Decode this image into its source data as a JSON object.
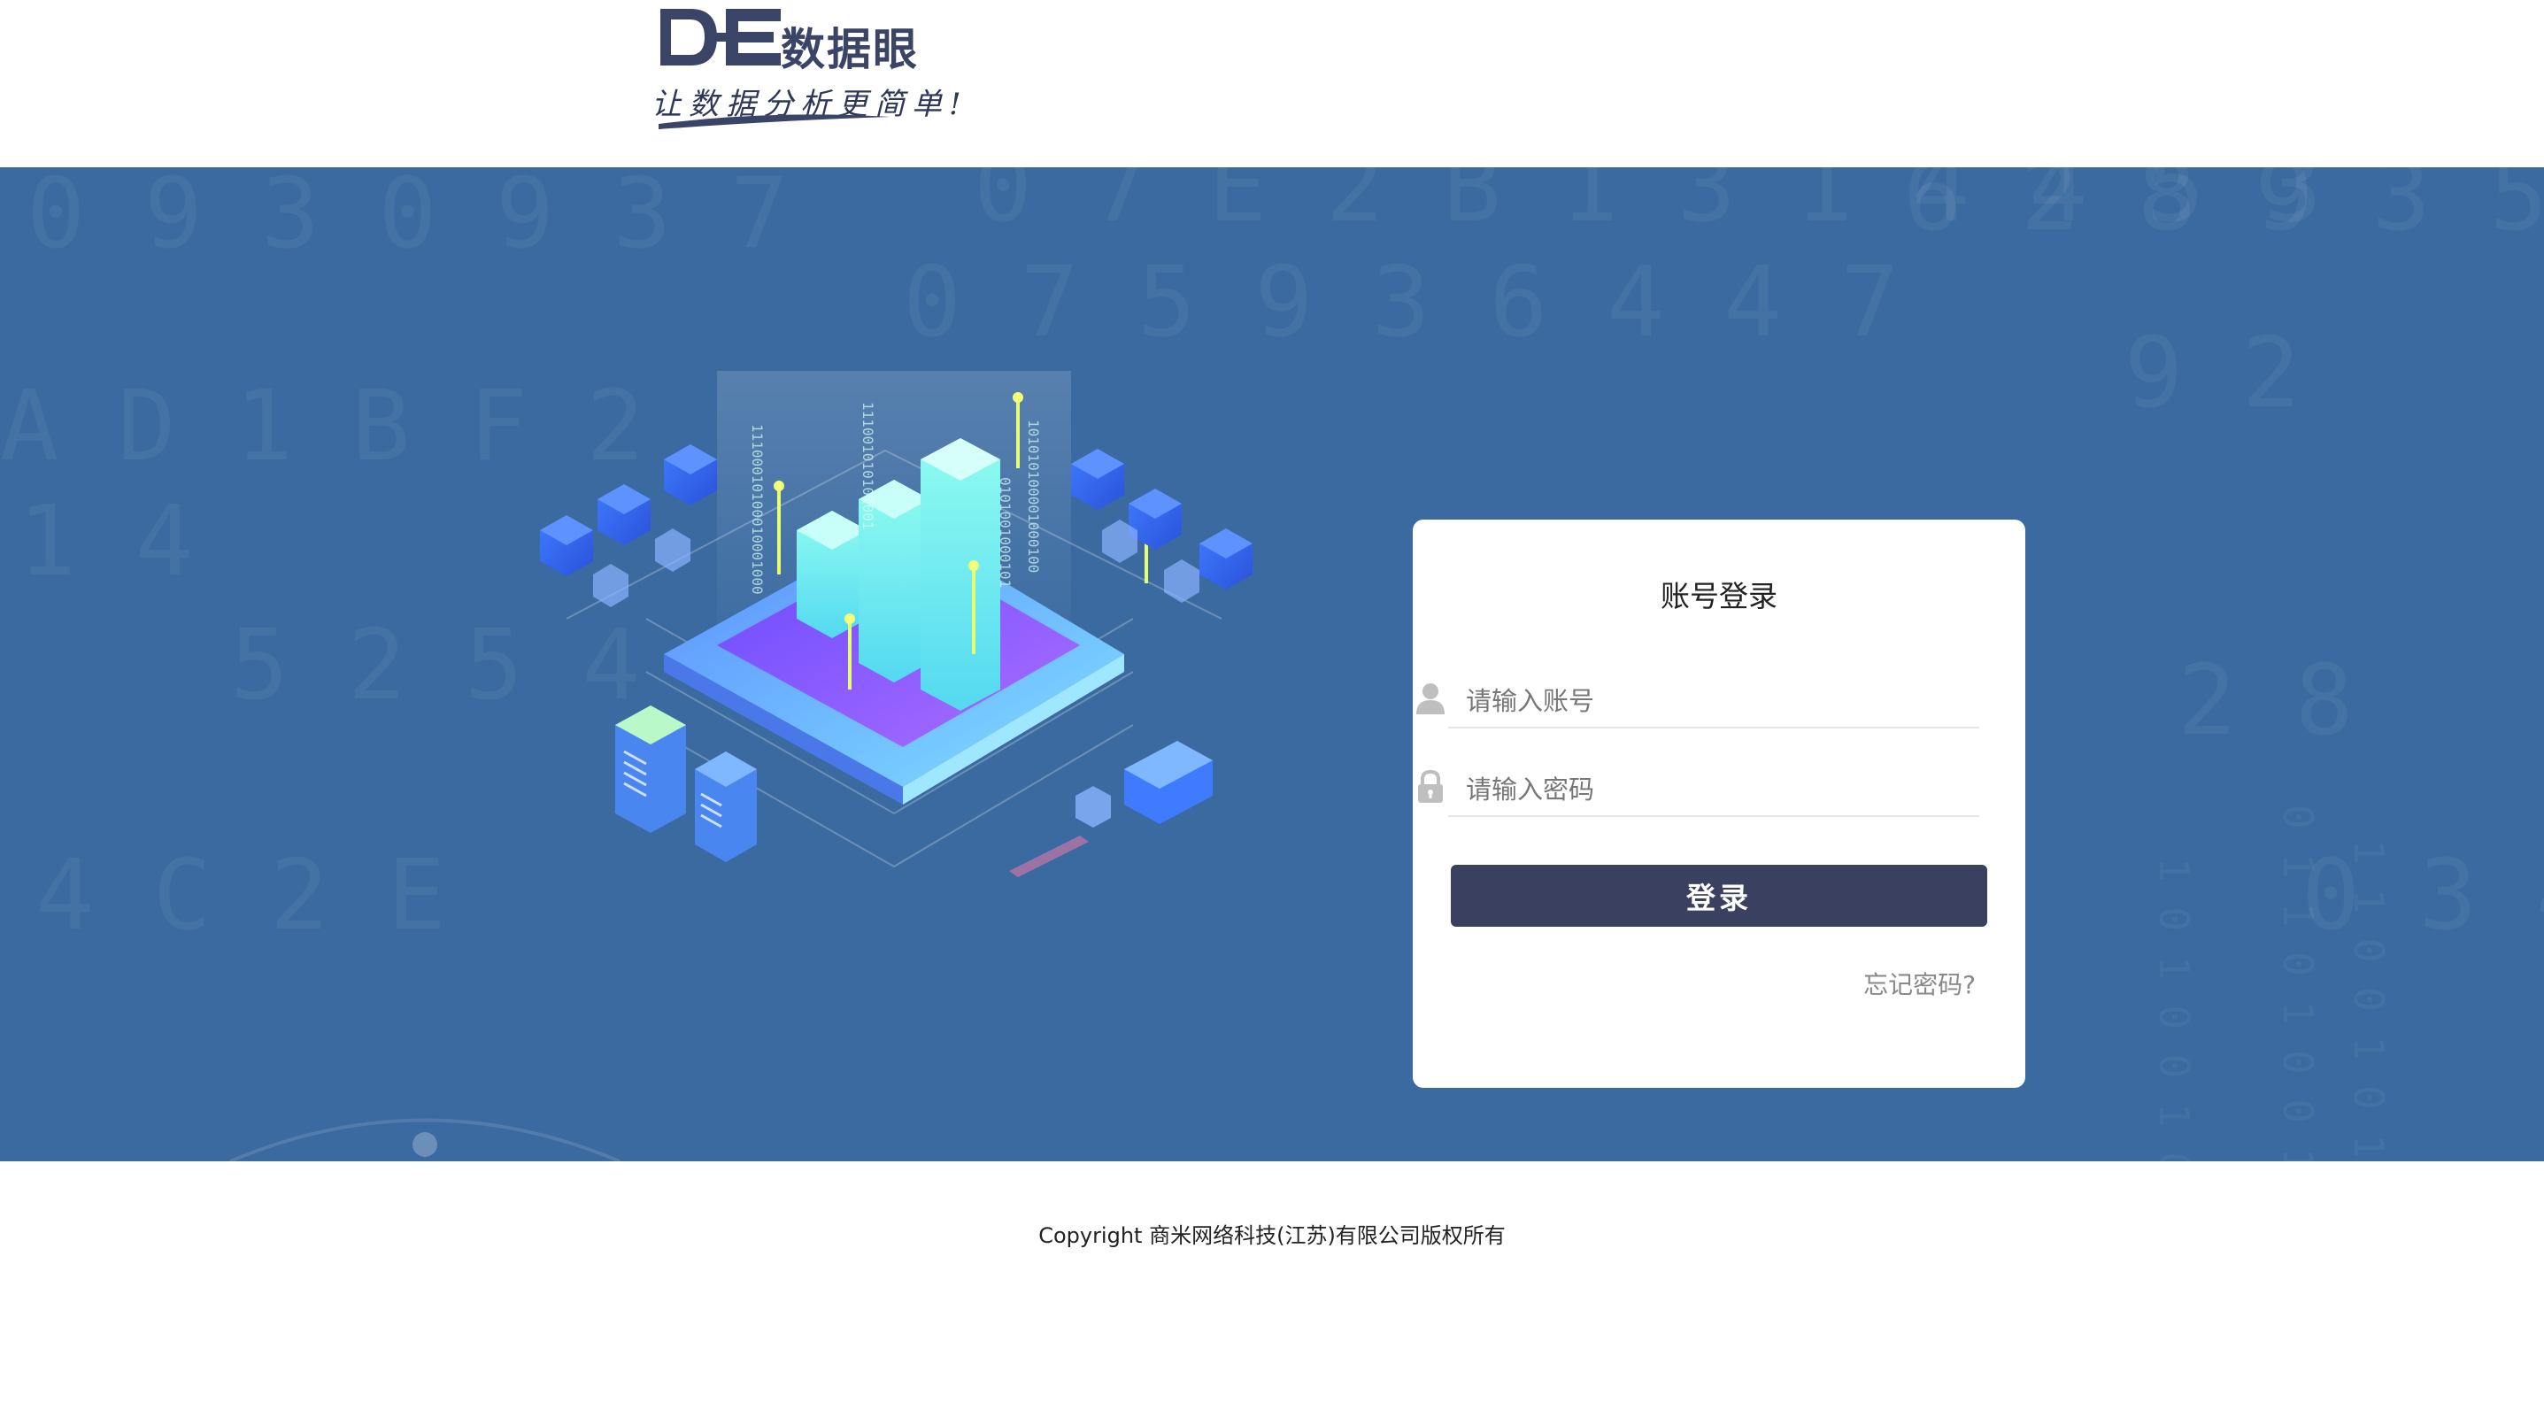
{
  "header": {
    "logo": {
      "brand": "数据眼",
      "slogan": "让数据分析更简单!",
      "mark_letters": "DE"
    }
  },
  "banner": {
    "background_color": "#3a6aa0",
    "illustration": "isometric-data-center"
  },
  "login": {
    "title": "账号登录",
    "username": {
      "placeholder": "请输入账号",
      "value": "",
      "icon": "user-icon"
    },
    "password": {
      "placeholder": "请输入密码",
      "value": "",
      "icon": "lock-icon"
    },
    "submit_label": "登录",
    "forgot_label": "忘记密码?"
  },
  "footer": {
    "copyright": "Copyright 商米网络科技(江苏)有限公司版权所有"
  },
  "colors": {
    "primary_button": "#3a4160",
    "banner": "#3a6aa0",
    "brand": "#3a4466"
  }
}
